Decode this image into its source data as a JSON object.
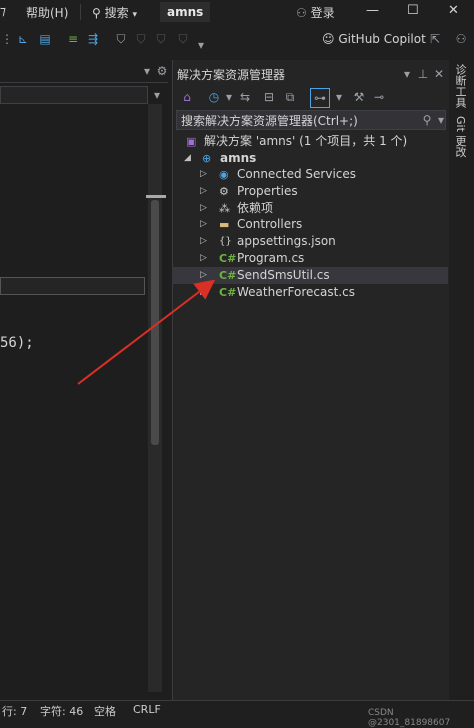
{
  "menu": {
    "help": "帮助(H)",
    "search": "搜索",
    "project": "amns",
    "login": "登录"
  },
  "window_controls": {
    "minimize": "—",
    "maximize": "☐",
    "close": "✕"
  },
  "toolbar": {
    "copilot_label": "GitHub Copilot"
  },
  "editor": {
    "code_fragment": "56);"
  },
  "solution_explorer": {
    "title": "解决方案资源管理器",
    "search_placeholder": "搜索解决方案资源管理器(Ctrl+;)",
    "solution_label": "解决方案 'amns' (1 个项目，共 1 个)",
    "project_label": "amns",
    "items": [
      {
        "label": "Connected Services",
        "icon": "connected-services-icon"
      },
      {
        "label": "Properties",
        "icon": "properties-icon"
      },
      {
        "label": "依赖项",
        "icon": "dependencies-icon"
      },
      {
        "label": "Controllers",
        "icon": "folder-icon"
      },
      {
        "label": "appsettings.json",
        "icon": "json-file-icon"
      },
      {
        "label": "Program.cs",
        "icon": "csharp-file-icon"
      },
      {
        "label": "SendSmsUtil.cs",
        "icon": "csharp-file-icon",
        "selected": true
      },
      {
        "label": "WeatherForecast.cs",
        "icon": "csharp-file-icon"
      }
    ]
  },
  "side_tabs": {
    "diagnostics": "诊断工具",
    "git": "Git 更改"
  },
  "status_bar": {
    "line": "行: 7",
    "char": "字符: 46",
    "spaces": "空格",
    "eol": "CRLF"
  },
  "watermark": "CSDN @2301_81898607",
  "colors": {
    "accent_arrow": "#d93025",
    "csharp_green": "#6db33f",
    "folder_yellow": "#dcb67a"
  }
}
